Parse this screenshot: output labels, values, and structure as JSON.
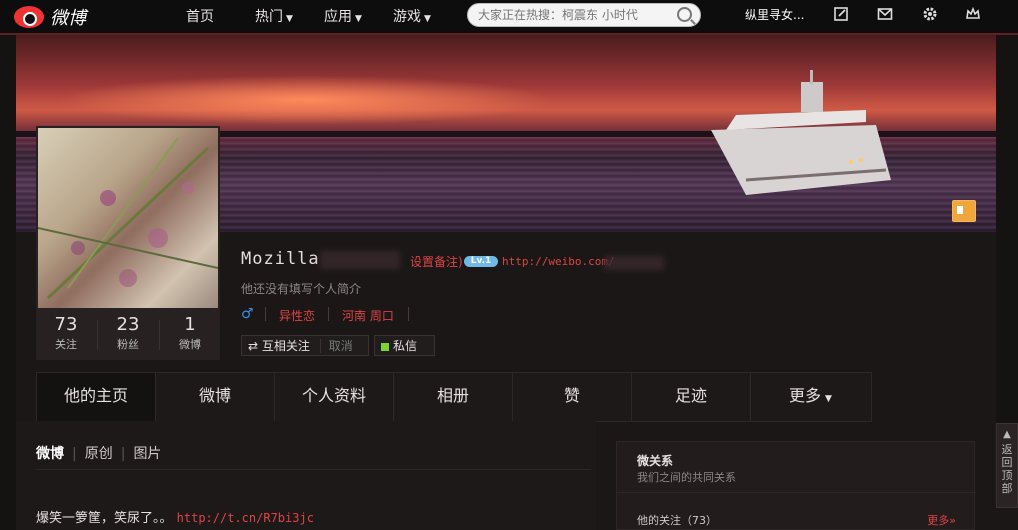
{
  "nav": {
    "logo_text": "微博",
    "items": [
      {
        "label": "首页",
        "caret": ""
      },
      {
        "label": "热门",
        "caret": "▼"
      },
      {
        "label": "应用",
        "caret": "▼"
      },
      {
        "label": "游戏",
        "caret": "▼"
      }
    ],
    "search_placeholder": "大家正在热搜：柯震东 小时代",
    "user_name": "纵里寻女...",
    "icons": [
      "edit-icon",
      "mail-icon",
      "gear-icon",
      "crown-icon"
    ]
  },
  "profile": {
    "name": "Mozilla",
    "remark": "设置备注)",
    "level": "Lv.1",
    "url": "http://weibo.com/",
    "bio": "他还没有填写个人简介",
    "gender_symbol": "♂",
    "tags": [
      "异性恋",
      "河南  周口"
    ],
    "buttons": {
      "mutual": "互相关注",
      "cancel": "取消",
      "message": "私信"
    },
    "stats": [
      {
        "num": "73",
        "label": "关注"
      },
      {
        "num": "23",
        "label": "粉丝"
      },
      {
        "num": "1",
        "label": "微博"
      }
    ]
  },
  "tabs": [
    {
      "label": "他的主页",
      "caret": ""
    },
    {
      "label": "微博",
      "caret": ""
    },
    {
      "label": "个人资料",
      "caret": ""
    },
    {
      "label": "相册",
      "caret": ""
    },
    {
      "label": "赞",
      "caret": ""
    },
    {
      "label": "足迹",
      "caret": ""
    },
    {
      "label": "更多",
      "caret": "▼"
    }
  ],
  "feed": {
    "filters": [
      "微博",
      "原创",
      "图片"
    ],
    "post_text": "爆笑一箩筐，笑尿了。。",
    "post_link": "http://t.cn/R7bi3jc"
  },
  "sidebar": {
    "title": "微关系",
    "subtitle": "我们之间的共同关系",
    "follows": "他的关注（73）",
    "more": "更多»"
  },
  "backtop": {
    "label": "返回顶部"
  }
}
